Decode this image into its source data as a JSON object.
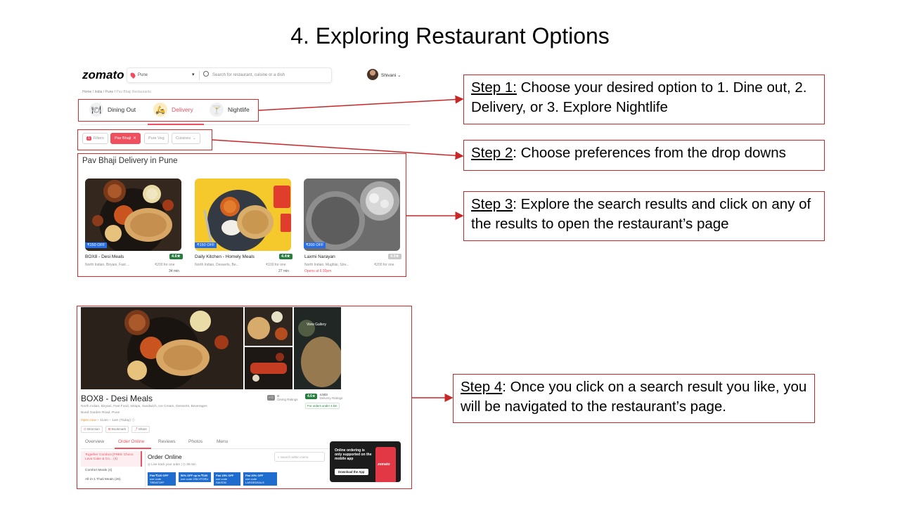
{
  "slide_title": "4. Exploring Restaurant Options",
  "app": {
    "logo": "zomato",
    "location": "Pune",
    "search_placeholder": "Search for restaurant, cuisine or a dish",
    "user_name": "Shivani",
    "breadcrumb": [
      "Home",
      "/",
      "India",
      "/",
      "Pune",
      "/",
      "Pav Bhaji Restaurants"
    ],
    "tabs": [
      {
        "label": "Dining Out",
        "icon": "dining-out-icon"
      },
      {
        "label": "Delivery",
        "icon": "delivery-icon",
        "active": true
      },
      {
        "label": "Nightlife",
        "icon": "nightlife-icon"
      }
    ],
    "filters": {
      "count": "1",
      "filters_label": "Filters",
      "active_filter": "Pav Bhaji",
      "pure_veg": "Pure Veg",
      "cuisines": "Cuisines"
    },
    "section_title": "Pav Bhaji Delivery in Pune",
    "restaurants": [
      {
        "name": "BOX8 - Desi Meals",
        "rating": "4.6★",
        "cuisines": "North Indian, Biryani, Fast ...",
        "price": "₹200 for one",
        "time": "34 min",
        "offer": "₹150 OFF"
      },
      {
        "name": "Daily Kitchen - Homely Meals",
        "rating": "4.4★",
        "cuisines": "North Indian, Desserts, Be...",
        "price": "₹100 for one",
        "time": "27 min",
        "offer": "₹150 OFF"
      },
      {
        "name": "Laxmi Narayan",
        "rating": "4.0★",
        "cuisines": "North Indian, Mughlai, Stre...",
        "price": "₹200 for one",
        "time": "Opens at 6:30pm",
        "offer": "₹200 OFF"
      }
    ]
  },
  "restaurant_page": {
    "name": "BOX8 - Desi Meals",
    "cuisines": "North Indian, Biryani, Fast Food, Wraps, Sandwich, Ice Cream, Desserts, Beverages",
    "address": "Bund Garden Road, Pune",
    "hours_status": "Open now",
    "hours": "11am – 1am (Today)",
    "view_gallery": "View Gallery",
    "dining_count": "0",
    "dining_label": "Dining Ratings",
    "delivery_rating": "4.6★",
    "delivery_count": "4,503",
    "delivery_label": "Delivery Ratings",
    "order_note": "For orders under 4 km",
    "actions": [
      "Direction",
      "Bookmark",
      "Share"
    ],
    "tabs": [
      "Overview",
      "Order Online",
      "Reviews",
      "Photos",
      "Menu"
    ],
    "active_tab": "Order Online",
    "menu_categories": [
      "Together Combos [FREE Choco Lava Cake & Co... (4)",
      "Comfort Meals (4)",
      "All-in-1 Thali Meals (26)"
    ],
    "order_title": "Order Online",
    "live_track": "Live track your order",
    "eta": "38 min",
    "search_menu": "Search within menu",
    "promos": [
      {
        "title": "Flat ₹120 OFF",
        "code": "use code TREATOFF"
      },
      {
        "title": "50% OFF up to ₹100",
        "code": "use code ONLYFORU"
      },
      {
        "title": "Flat 15% OFF",
        "code": "use code SAVE30"
      },
      {
        "title": "Flat 20% OFF",
        "code": "use code LARGEDEALS"
      }
    ],
    "app_banner_text": "Online ordering is only supported on the mobile app",
    "app_banner_button": "Download the App",
    "app_banner_logo": "zomato"
  },
  "steps": [
    {
      "label": "Step 1:",
      "text": " Choose your desired option to 1. Dine out, 2. Delivery, or 3. Explore Nightlife"
    },
    {
      "label": "Step 2",
      "text": ": Choose preferences from the drop downs"
    },
    {
      "label": "Step 3",
      "text": ": Explore the search results and click on any of the results to open the restaurant’s page"
    },
    {
      "label": "Step 4",
      "text": ": Once you click on a search result you like, you will be navigated to the restaurant’s page."
    }
  ],
  "colors": {
    "zomato_red": "#ef4f5f",
    "annotation_red": "#c62828",
    "rating_green": "#267e3e",
    "offer_blue": "#256fef"
  }
}
